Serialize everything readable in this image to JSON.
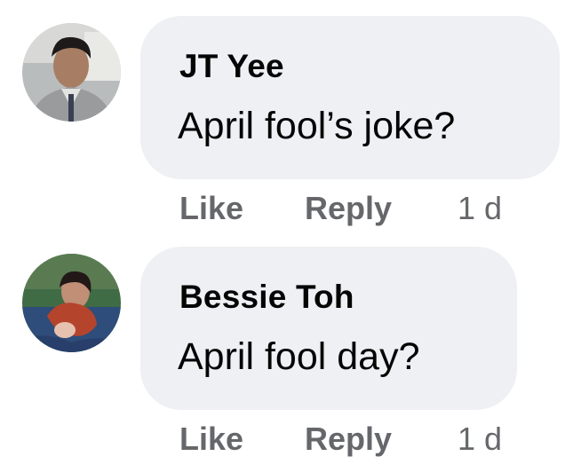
{
  "comments": [
    {
      "author": "JT Yee",
      "text": "April fool’s joke?",
      "like_label": "Like",
      "reply_label": "Reply",
      "timestamp": "1 d"
    },
    {
      "author": "Bessie Toh",
      "text": "April fool day?",
      "like_label": "Like",
      "reply_label": "Reply",
      "timestamp": "1 d"
    }
  ],
  "colors": {
    "bubble": "#eff0f4",
    "text": "#050505",
    "secondary_text": "#65676b"
  }
}
